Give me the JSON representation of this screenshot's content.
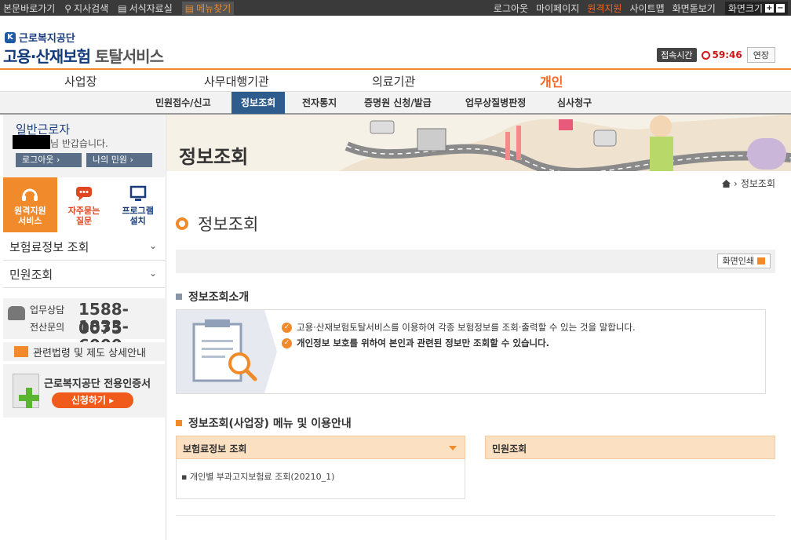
{
  "topbar": {
    "left": [
      "본문바로가기",
      "지사검색",
      "서식자료실",
      "메뉴찾기"
    ],
    "right": [
      "로그아웃",
      "마이페이지",
      "원격지원",
      "사이트맵",
      "화면돋보기"
    ],
    "fontsize_label": "화면크기"
  },
  "header": {
    "org": "근로복지공단",
    "service_main": "고용·산재보험",
    "service_sub": "토탈서비스",
    "session_label": "접속시간",
    "timer": "59:46",
    "extend": "연장"
  },
  "mainnav": [
    "사업장",
    "사무대행기관",
    "의료기관",
    "개인"
  ],
  "subnav": [
    "민원접수/신고",
    "정보조회",
    "전자통지",
    "증명원 신청/발급",
    "업무상질병판정",
    "심사청구"
  ],
  "sidebar": {
    "username": "일반근로자",
    "greeting": "님 반갑습니다.",
    "logout": "로그아웃",
    "my": "나의 민원",
    "quick": [
      {
        "l1": "원격지원",
        "l2": "서비스"
      },
      {
        "l1": "자주묻는",
        "l2": "질문"
      },
      {
        "l1": "프로그램",
        "l2": "설치"
      }
    ],
    "accordion": [
      "보험료정보 조회",
      "민원조회"
    ],
    "contact": {
      "l1": "업무상담",
      "n1": "1588-0075",
      "l2": "전산문의",
      "n2": "1833-6000"
    },
    "laws": "관련법령 및 제도 상세안내",
    "cert_title": "근로복지공단 전용인증서",
    "cert_button": "신청하기"
  },
  "content": {
    "banner_title": "정보조회",
    "breadcrumb": "정보조회",
    "page_title": "정보조회",
    "print": "화면인쇄",
    "sec1": "정보조회소개",
    "intro1": "고용·산재보험토탈서비스를 이용하여 각종 보험정보를 조회·출력할 수 있는 것을 말합니다.",
    "intro2": "개인정보 보호를 위하여 본인과 관련된 정보만 조회할 수 있습니다.",
    "sec2": "정보조회(사업장) 메뉴 및 이용안내",
    "menu1": "보험료정보 조회",
    "menu2": "민원조회",
    "list1": "개인별 부과고지보험료 조회(20210_1)"
  },
  "colors": {
    "accent": "#f08a2a",
    "nav_active": "#2e5c8c",
    "timer": "#d01515"
  }
}
